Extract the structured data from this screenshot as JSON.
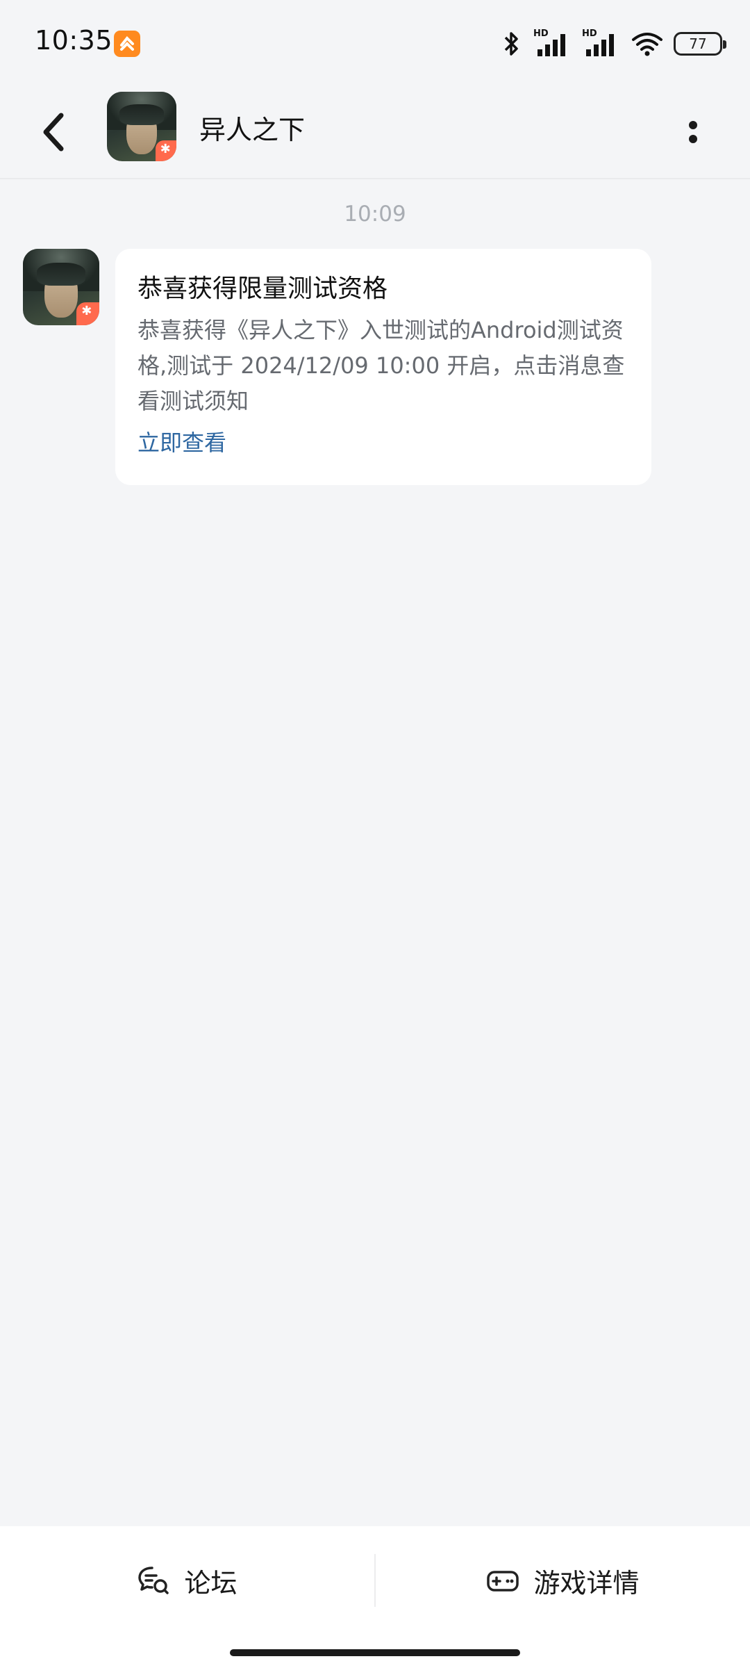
{
  "status_bar": {
    "time": "10:35",
    "app_icon": "orange-app-icon",
    "icons": [
      "bluetooth-icon",
      "hd-signal-icon",
      "hd-signal-icon",
      "wifi-icon"
    ],
    "signal_label": "HD",
    "battery": "77"
  },
  "header": {
    "title": "异人之下",
    "back_icon": "chevron-left-icon",
    "more_icon": "more-vertical-icon"
  },
  "chat": {
    "timestamp": "10:09",
    "message": {
      "title": "恭喜获得限量测试资格",
      "body": "恭喜获得《异人之下》入世测试的Android测试资格,测试于 2024/12/09 10:00 开启，点击消息查看测试须知",
      "link": "立即查看"
    }
  },
  "bottom_bar": {
    "forum_label": "论坛",
    "forum_icon": "forum-chat-icon",
    "detail_label": "游戏详情",
    "detail_icon": "gamepad-icon"
  },
  "colors": {
    "background": "#f4f5f7",
    "link": "#2e67a1",
    "badge": "#ff6a4d",
    "status_app": "#ff8a1f"
  }
}
